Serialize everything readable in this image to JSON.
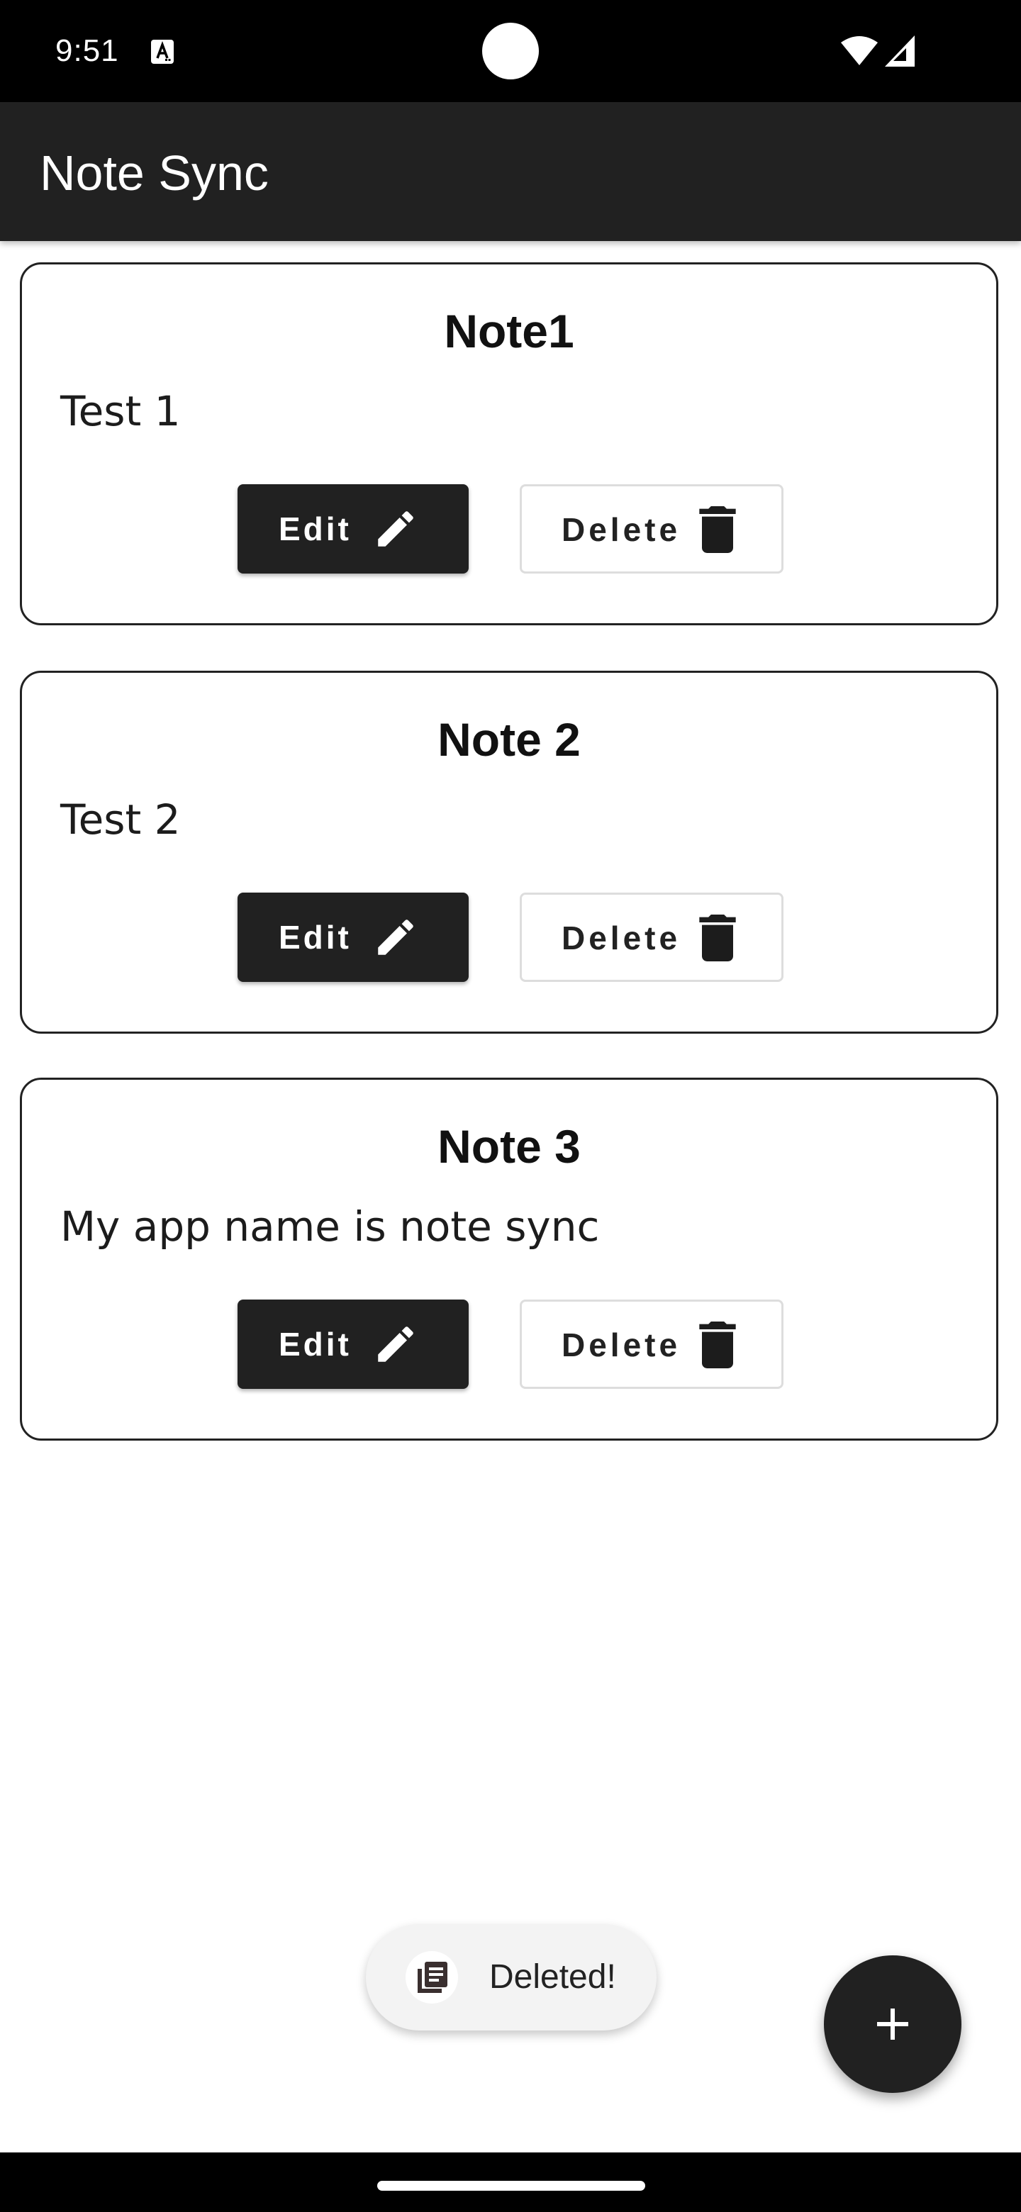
{
  "status_bar": {
    "time": "9:51",
    "icons": [
      "a-notification-icon",
      "wifi-icon",
      "cellular-signal-icon"
    ]
  },
  "app_bar": {
    "title": "Note Sync"
  },
  "notes": [
    {
      "title": "Note1",
      "body": "Test 1",
      "edit_label": "Edit",
      "delete_label": "Delete"
    },
    {
      "title": "Note 2",
      "body": "Test 2",
      "edit_label": "Edit",
      "delete_label": "Delete"
    },
    {
      "title": "Note 3",
      "body": "My app name is note sync",
      "edit_label": "Edit",
      "delete_label": "Delete"
    }
  ],
  "toast": {
    "message": "Deleted!",
    "icon": "notes-app-icon"
  },
  "fab": {
    "icon": "plus-icon"
  },
  "colors": {
    "app_bar": "#212121",
    "edit_button": "#212121",
    "fab": "#212121",
    "card_border": "#222222",
    "background": "#ffffff"
  }
}
